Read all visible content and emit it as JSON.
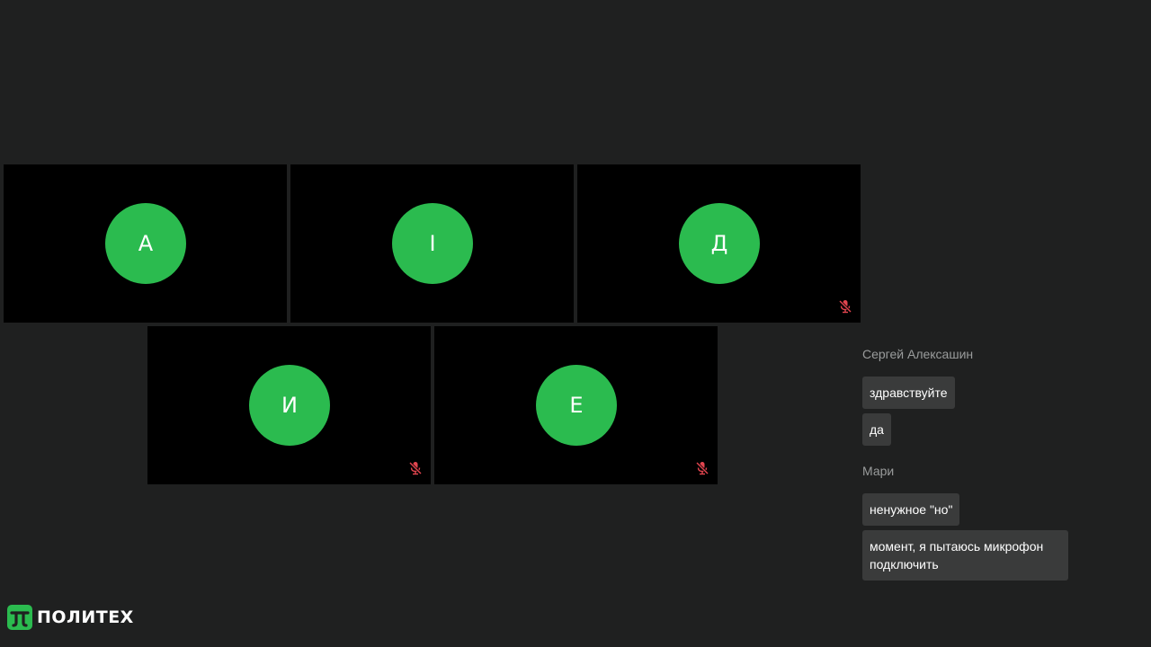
{
  "participants": [
    {
      "initial": "А",
      "muted": false
    },
    {
      "initial": "І",
      "muted": false
    },
    {
      "initial": "Д",
      "muted": true
    },
    {
      "initial": "И",
      "muted": true
    },
    {
      "initial": "Е",
      "muted": true
    }
  ],
  "chat": {
    "groups": [
      {
        "author": "Сергей Алексашин",
        "messages": [
          "здравствуйте",
          "да"
        ]
      },
      {
        "author": "Мари",
        "messages": [
          "ненужное \"но\"",
          "момент, я пытаюсь микрофон подключить"
        ]
      }
    ]
  },
  "brand": {
    "name": "ПОЛИТЕХ"
  },
  "colors": {
    "background": "#1f2020",
    "tile": "#000000",
    "avatar": "#2bbb4f",
    "mute_icon": "#e2454f",
    "bubble": "#3a3b3b",
    "author_text": "#9a9c9c"
  },
  "icons": {
    "mute": "microphone-off-icon",
    "logo": "politech-logo"
  }
}
